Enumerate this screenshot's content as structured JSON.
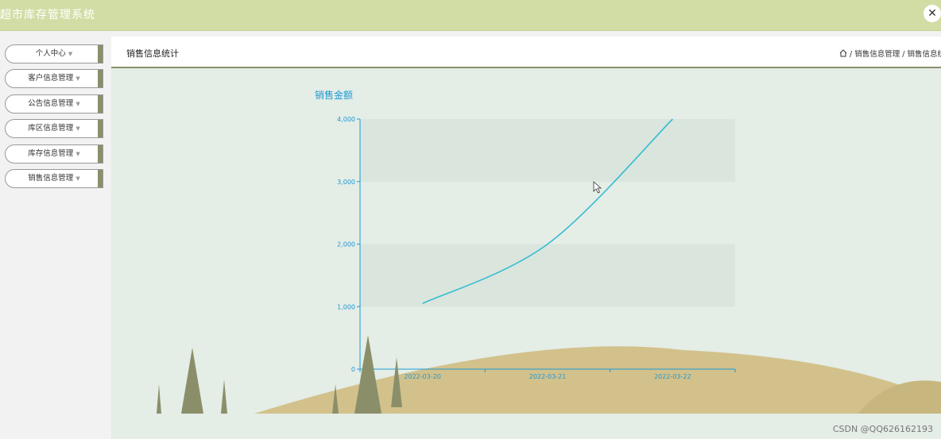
{
  "app": {
    "title": "超市库存管理系统",
    "close_icon": "✕"
  },
  "sidebar": {
    "items": [
      {
        "label": "个人中心"
      },
      {
        "label": "客户信息管理"
      },
      {
        "label": "公告信息管理"
      },
      {
        "label": "库区信息管理"
      },
      {
        "label": "库存信息管理"
      },
      {
        "label": "销售信息管理"
      }
    ]
  },
  "header": {
    "title": "销售信息统计",
    "breadcrumb": "/ 销售信息管理 / 销售信息统计",
    "home_icon": "home-icon"
  },
  "chart_data": {
    "type": "line",
    "title": "销售金额",
    "categories": [
      "2022-03-20",
      "2022-03-21",
      "2022-03-22"
    ],
    "values": [
      1050,
      2000,
      4000
    ],
    "ylim": [
      0,
      4000
    ],
    "yticks": [
      "0",
      "1,000",
      "2,000",
      "3,000",
      "4,000"
    ],
    "smooth": true,
    "color": "#36bdd0",
    "axis_color": "#1f9ad6",
    "grid": "alternating bands"
  },
  "watermark": "CSDN @QQ626162193"
}
